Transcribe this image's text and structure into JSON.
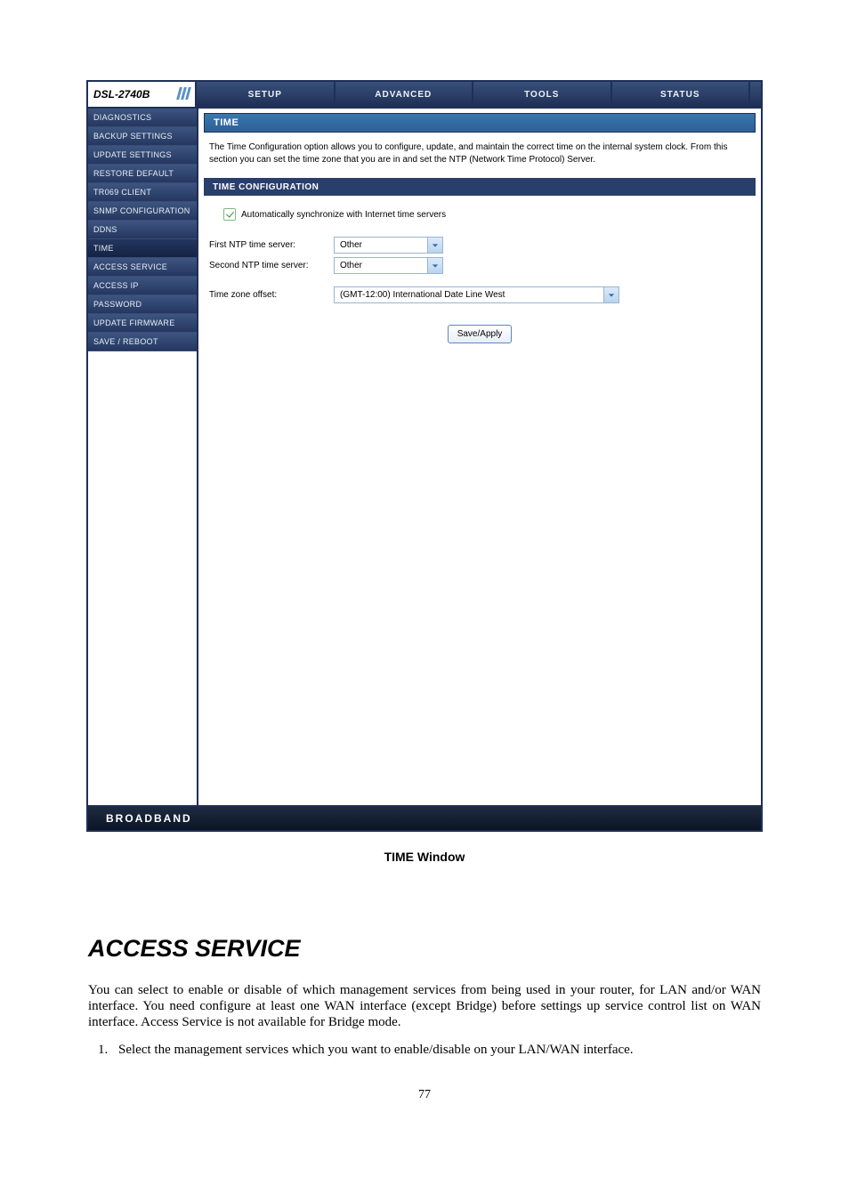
{
  "brand": "DSL-2740B",
  "tabs": [
    "SETUP",
    "ADVANCED",
    "TOOLS",
    "STATUS"
  ],
  "sidebar": {
    "items": [
      {
        "label": "DIAGNOSTICS"
      },
      {
        "label": "BACKUP SETTINGS"
      },
      {
        "label": "UPDATE SETTINGS"
      },
      {
        "label": "RESTORE DEFAULT"
      },
      {
        "label": "TR069 CLIENT"
      },
      {
        "label": "SNMP CONFIGURATION"
      },
      {
        "label": "DDNS"
      },
      {
        "label": "TIME"
      },
      {
        "label": "ACCESS SERVICE"
      },
      {
        "label": "ACCESS IP"
      },
      {
        "label": "PASSWORD"
      },
      {
        "label": "UPDATE FIRMWARE"
      },
      {
        "label": "SAVE / REBOOT"
      }
    ]
  },
  "main": {
    "section_title": "TIME",
    "section_text": "The Time Configuration option allows you to configure, update, and maintain the correct time on the internal system clock. From this section you can set the time zone that you are in and set the NTP (Network Time Protocol) Server.",
    "config_title": "TIME CONFIGURATION",
    "auto_sync_label": "Automatically synchronize with Internet time servers",
    "rows": {
      "ntp1_label": "First NTP time server:",
      "ntp1_value": "Other",
      "ntp2_label": "Second NTP time server:",
      "ntp2_value": "Other",
      "tz_label": "Time zone offset:",
      "tz_value": "(GMT-12:00) International Date Line West"
    },
    "save_button": "Save/Apply"
  },
  "footer_brand": "BROADBAND",
  "caption": "TIME Window",
  "doc": {
    "heading": "ACCESS SERVICE",
    "para": "You can select to enable or disable of which management services from being used in your router, for LAN and/or WAN interface. You need configure at least one WAN interface (except Bridge) before settings up service control list on WAN interface. Access Service is not available for Bridge mode.",
    "li1": "Select the management services which you want to enable/disable on your LAN/WAN interface."
  },
  "page_number": "77"
}
